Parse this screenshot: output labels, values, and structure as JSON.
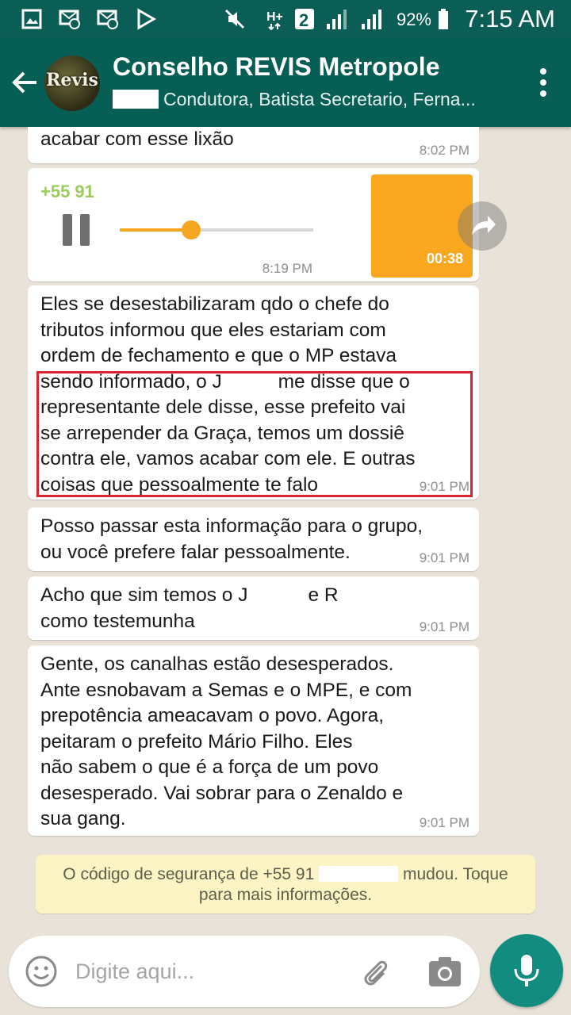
{
  "status_bar": {
    "battery_percent": "92%",
    "time": "7:15 AM"
  },
  "header": {
    "avatar_text": "Revis",
    "title": "Conselho REVIS Metropole",
    "subtitle": "Condutora, Batista Secretario, Ferna..."
  },
  "messages": [
    {
      "text": "acabar com esse lixão",
      "time": "8:02 PM"
    },
    {
      "type": "voice",
      "sender": "+55 91",
      "duration": "00:38",
      "time": "8:19 PM",
      "progress": 0.37
    },
    {
      "text_a": "Eles se desestabilizaram qdo o chefe do\ntributos informou que eles estariam com\nordem de fechamento e que o MP estava\nsendo informado, o J",
      "text_b": " me disse que o\nrepresentante dele disse, esse prefeito vai\nse arrepender da Graça, temos um dossiê\ncontra ele, vamos acabar com ele. E outras\ncoisas que pessoalmente te falo",
      "time": "9:01 PM"
    },
    {
      "text": "Posso passar esta informação para o grupo,\nou você prefere falar pessoalmente.",
      "time": "9:01 PM"
    },
    {
      "text_a": "Acho que sim temos o J",
      "text_b": "e R",
      "text_c": "\ncomo testemunha",
      "time": "9:01 PM"
    },
    {
      "text": "Gente, os canalhas estão desesperados.\nAnte esnobavam a Semas e o MPE, e com\nprepotência ameacavam o povo. Agora,\npeitaram o prefeito Mário Filho. Eles\nnão sabem o que é a força de um povo\ndesesperado. Vai sobrar para o Zenaldo e\nsua gang.",
      "time": "9:01 PM"
    }
  ],
  "security_notice": {
    "text_a": "O código de segurança de +55 91",
    "text_b": "mudou. Toque",
    "text_c": "para mais informações."
  },
  "input": {
    "placeholder": "Digite aqui..."
  },
  "colors": {
    "app_bar": "#075e54",
    "status_bar": "#0b5e55",
    "accent_audio": "#f4a620",
    "mic_button": "#128c7e",
    "highlight_border": "#d9232e"
  },
  "icons": [
    "gallery-icon",
    "mail-at-icon",
    "mail-at-icon",
    "play-store-icon",
    "mute-icon",
    "network-h-plus-icon",
    "sim-2-icon",
    "signal-icon",
    "signal-icon",
    "battery-icon",
    "back-arrow-icon",
    "more-vert-icon",
    "pause-icon",
    "forward-icon",
    "emoji-icon",
    "attach-icon",
    "camera-icon",
    "mic-icon"
  ]
}
